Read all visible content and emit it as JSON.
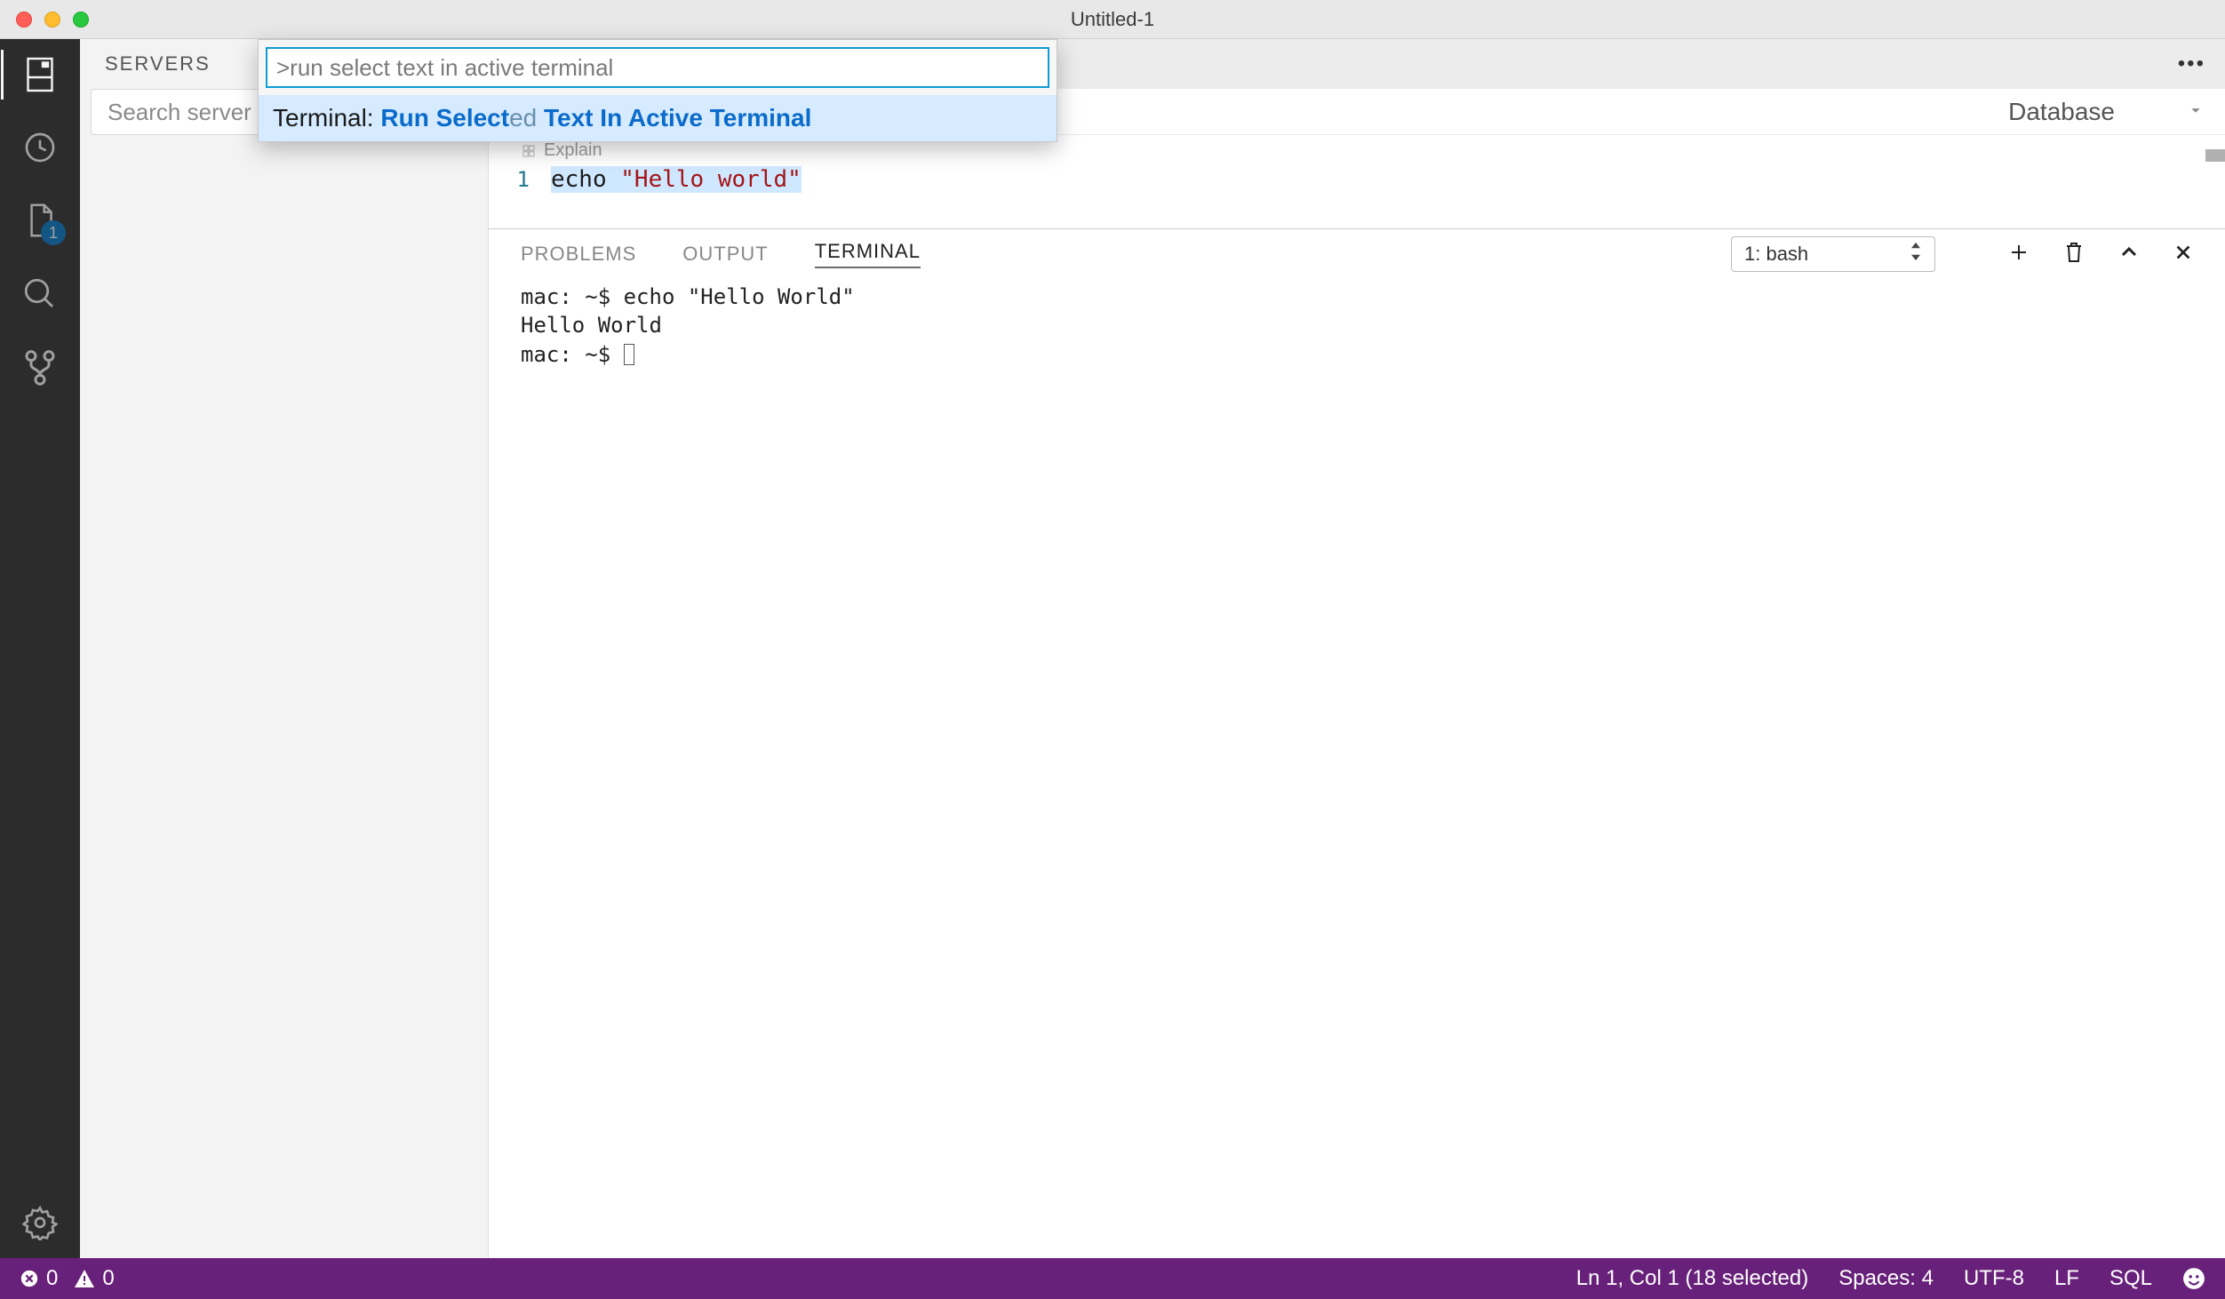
{
  "window": {
    "title": "Untitled-1"
  },
  "sidebar": {
    "header": "SERVERS",
    "search_placeholder": "Search server names",
    "file_badge": "1"
  },
  "editor_header": {
    "database_label": "Database"
  },
  "codelens": {
    "label": "Explain"
  },
  "code": {
    "line_no": "1",
    "token_echo": "echo ",
    "token_str": "\"Hello world\""
  },
  "panel": {
    "tabs": {
      "problems": "PROBLEMS",
      "output": "OUTPUT",
      "terminal": "TERMINAL"
    },
    "term_select": "1: bash",
    "terminal_lines": [
      "mac: ~$ echo \"Hello World\"",
      "Hello World",
      "mac: ~$ "
    ]
  },
  "status": {
    "errors": "0",
    "warnings": "0",
    "cursor": "Ln 1, Col 1 (18 selected)",
    "spaces": "Spaces: 4",
    "encoding": "UTF-8",
    "eol": "LF",
    "lang": "SQL"
  },
  "palette": {
    "query": ">run select text in active terminal",
    "result_prefix": "Terminal: ",
    "result_bold1": "Run Select",
    "result_dim": "ed ",
    "result_bold2": "Text In Active Terminal"
  }
}
